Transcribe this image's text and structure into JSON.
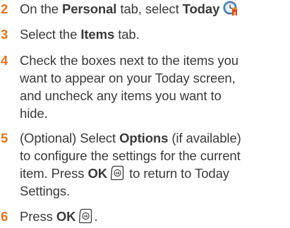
{
  "steps": [
    {
      "num": "2",
      "t1": "On the ",
      "b1": "Personal",
      "t2": " tab, select ",
      "b2": "Today"
    },
    {
      "num": "3",
      "t1": "Select the ",
      "b1": "Items",
      "t2": " tab."
    },
    {
      "num": "4",
      "lines": [
        "Check the boxes next to the items you",
        "want to appear on your Today screen,",
        "and uncheck any items you want to",
        "hide."
      ]
    },
    {
      "num": "5",
      "l1a": "(Optional)  Select ",
      "l1b": "Options",
      "l1c": " (if available)",
      "l2": "to configure the settings for the current",
      "l3a": "item. Press ",
      "l3b": "OK",
      "l3c": " to return to Today",
      "l4": "Settings."
    },
    {
      "num": "6",
      "t1": "Press ",
      "b1": "OK",
      "t2": "."
    }
  ],
  "colors": {
    "step_number": "#e0731f",
    "text": "#3a3a3a"
  },
  "icons": {
    "today": "today-clock-icon",
    "ok_key": "ok-button-key-icon"
  }
}
